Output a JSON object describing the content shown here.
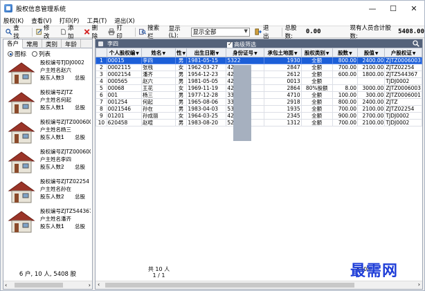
{
  "window": {
    "title": "股权信息管理系统",
    "minimize": "—",
    "maximize": "☐",
    "close": "✕"
  },
  "menu": [
    "股权(K)",
    "查看(V)",
    "打印(P)",
    "工具(T)",
    "退出(X)"
  ],
  "toolbar": {
    "find": "查找",
    "edit": "修改",
    "add": "添加",
    "delete": "删除",
    "print": "打印",
    "search_bar": "搜索栏",
    "display_label": "显示(L):",
    "display_value": "显示全部",
    "exit": "退出",
    "total_shares_label": "总股数:",
    "total_shares_value": "0.00",
    "total_capital_label": "现有人员合计股数:",
    "total_capital_value": "5408.00"
  },
  "left": {
    "tabs": [
      "各户",
      "常用",
      "类别",
      "年龄"
    ],
    "view_modes": [
      "图标",
      "列表"
    ],
    "field_labels": {
      "id": "股权编号:",
      "owner": "户主姓名:",
      "count": "股东人数:",
      "shares": "总股"
    },
    "cards": [
      {
        "id": "TJDJ0002",
        "owner": "赵六",
        "count": "3"
      },
      {
        "id": "ZJTZ",
        "owner": "何起",
        "count": "1"
      },
      {
        "id": "ZJTZ0006001",
        "owner": "杨三",
        "count": "1"
      },
      {
        "id": "ZJTZ0006003",
        "owner": "李四",
        "count": "2"
      },
      {
        "id": "ZJTZ02254",
        "owner": "孙在",
        "count": "2"
      },
      {
        "id": "ZJTZ544367",
        "owner": "潘齐",
        "count": "1"
      }
    ],
    "footer": "6 户, 10 人, 5408 股",
    "scroll_left": "‹",
    "scroll_right": "›"
  },
  "grid": {
    "header_name": "李四",
    "advanced_filter": "高级筛选",
    "columns": [
      "",
      "个人股权编",
      "姓名",
      "性",
      "出生日期",
      "身份证号",
      "承包土地面",
      "股权类别",
      "股数",
      "股值",
      "户股权证"
    ],
    "rows": [
      [
        "1",
        "00015",
        "李四",
        "男",
        "1981-05-15",
        "5322",
        "1930",
        "全额",
        "800.00",
        "2400.00",
        "ZJTZ0006003"
      ],
      [
        "2",
        "0002115",
        "张栈",
        "女",
        "1962-03-27",
        "4211",
        "2847",
        "全额",
        "700.00",
        "2100.00",
        "ZJTZ02254"
      ],
      [
        "3",
        "0002154",
        "潘齐",
        "男",
        "1954-12-23",
        "4211",
        "2612",
        "全额",
        "600.00",
        "1800.00",
        "ZJTZ544367"
      ],
      [
        "4",
        "000565",
        "赵六",
        "男",
        "1981-05-05",
        "4211",
        "0013",
        "全额",
        "",
        "",
        "TJDJ0002"
      ],
      [
        "5",
        "00068",
        "王花",
        "女",
        "1969-11-19",
        "4211",
        "2864",
        "80%股额",
        "8.00",
        "3000.00",
        "ZJTZ0006003"
      ],
      [
        "6",
        "001",
        "杨三",
        "男",
        "1977-12-28",
        "3326",
        "4710",
        "全额",
        "100.00",
        "300.00",
        "ZJTZ0006001"
      ],
      [
        "7",
        "001254",
        "何起",
        "男",
        "1965-08-06",
        "3326",
        "2918",
        "全额",
        "800.00",
        "2400.00",
        "ZJTZ"
      ],
      [
        "8",
        "0021546",
        "孙在",
        "男",
        "1983-04-03",
        "5303",
        "1935",
        "全额",
        "700.00",
        "2100.00",
        "ZJTZ02254"
      ],
      [
        "9",
        "01201",
        "孙成丽",
        "女",
        "1964-03-25",
        "4211",
        "2345",
        "全额",
        "900.00",
        "2700.00",
        "TJDJ0002"
      ],
      [
        "10",
        "620458",
        "赵喧",
        "男",
        "1983-08-20",
        "5223",
        "1312",
        "全额",
        "700.00",
        "2100.00",
        "TJDJ0002"
      ]
    ],
    "footer_count": "共 10 人",
    "footer_page": "1 / 1",
    "footer_sum": "5408.",
    "scroll_left": "‹",
    "scroll_right": "›"
  },
  "watermark": "最需网",
  "colors": {
    "selection": "#1c5fd8",
    "grid_header": "#54627a",
    "watermark": "#1f3ed8"
  }
}
